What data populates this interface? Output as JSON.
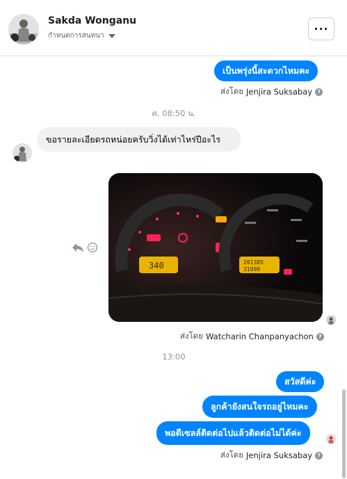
{
  "header": {
    "name": "Sakda Wonganu",
    "subtitle": "กำหนดการสนทนา",
    "more_label": "···"
  },
  "messages": {
    "out_1": "เป็นพรุ่งนี้สะดวกไหมคะ",
    "sent_label": "ส่งโดย",
    "sent_by_1": "Jenjira Suksabay",
    "time_1": "ศ. 08:50 น.",
    "in_1": "ขอรายละเอียดรถหน่อยครับวิ่งได้เท่าไหร่ปีอะไร",
    "sent_by_photo": "Watcharin Chanpanyachon",
    "time_2": "13:00",
    "out_2": "สวัสดีค่ะ",
    "out_3": "ลูกค้ายังสนใจรถอยู่ไหมคะ",
    "out_4": "พอดีเซลล์ติดต่อไปแล้วติดต่อไม่ได้ค่ะ",
    "sent_by_2": "Jenjira Suksabay"
  },
  "photo": {
    "odo_left": "340",
    "odo_right_1": "201385",
    "odo_right_2": "31099"
  },
  "colors": {
    "accent": "#0084ff",
    "incoming_bubble": "#f1f0f0",
    "warning_red": "#ff2255",
    "warning_amber": "#ffaa00"
  },
  "icons": [
    "more-icon",
    "reply-icon",
    "emoji-icon",
    "help-icon",
    "chevron-down-icon"
  ]
}
